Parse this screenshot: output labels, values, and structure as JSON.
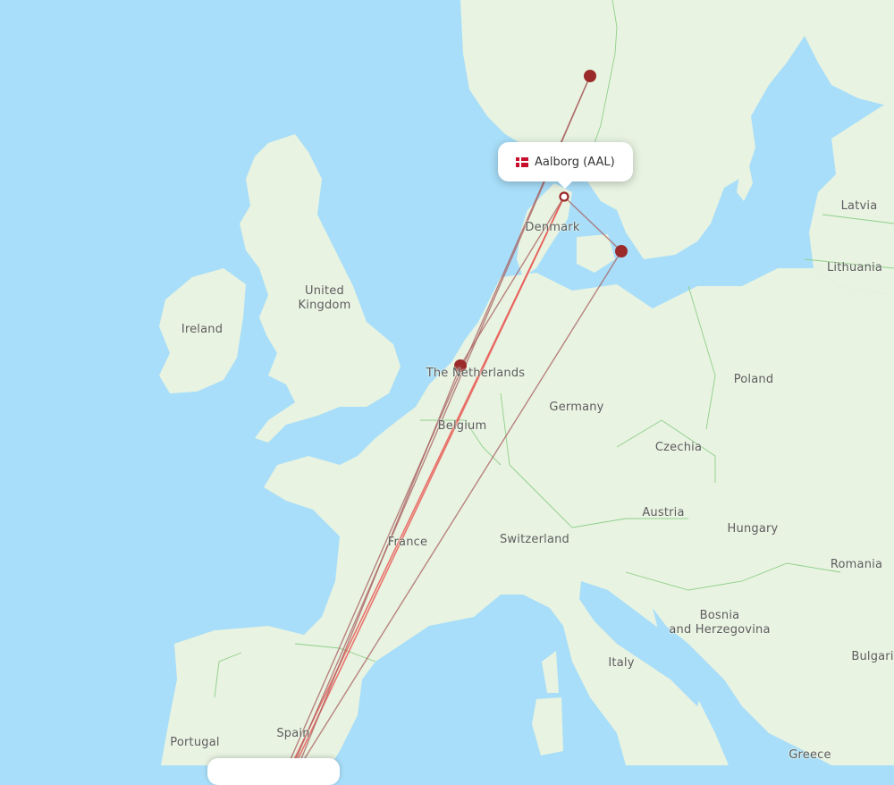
{
  "map": {
    "origin_airport": {
      "label": "Aalborg (AAL)",
      "country_flag": "denmark-flag-icon"
    },
    "colors": {
      "water": "#a8def9",
      "land": "#e8f3e1",
      "border": "#8fd08a",
      "route_dark": "#a85c5c",
      "route_red": "#e8534f",
      "destination_marker": "#9b2a2a"
    },
    "country_labels": [
      {
        "id": "ireland",
        "text": "Ireland"
      },
      {
        "id": "united-kingdom",
        "text": "United\nKingdom"
      },
      {
        "id": "denmark",
        "text": "Denmark"
      },
      {
        "id": "the-netherlands",
        "text": "The Netherlands"
      },
      {
        "id": "belgium",
        "text": "Belgium"
      },
      {
        "id": "germany",
        "text": "Germany"
      },
      {
        "id": "france",
        "text": "France"
      },
      {
        "id": "switzerland",
        "text": "Switzerland"
      },
      {
        "id": "czechia",
        "text": "Czechia"
      },
      {
        "id": "poland",
        "text": "Poland"
      },
      {
        "id": "austria",
        "text": "Austria"
      },
      {
        "id": "hungary",
        "text": "Hungary"
      },
      {
        "id": "romania",
        "text": "Romania"
      },
      {
        "id": "latvia",
        "text": "Latvia"
      },
      {
        "id": "lithuania",
        "text": "Lithuania"
      },
      {
        "id": "italy",
        "text": "Italy"
      },
      {
        "id": "bosnia",
        "text": "Bosnia\nand Herzegovina"
      },
      {
        "id": "bulgaria",
        "text": "Bulgari"
      },
      {
        "id": "greece",
        "text": "Greece"
      },
      {
        "id": "spain",
        "text": "Spain"
      },
      {
        "id": "portugal",
        "text": "Portugal"
      }
    ],
    "destination_markers": [
      {
        "id": "oslo"
      },
      {
        "id": "copenhagen"
      },
      {
        "id": "amsterdam"
      }
    ]
  }
}
